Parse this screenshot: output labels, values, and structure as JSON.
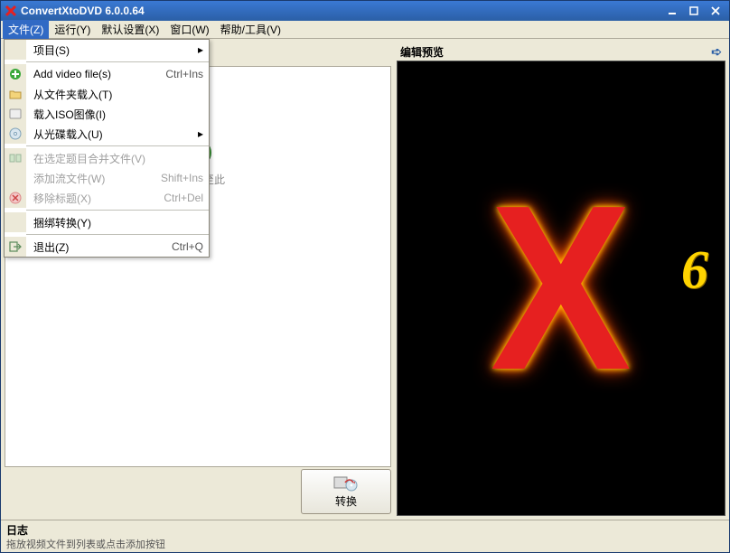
{
  "title": "ConvertXtoDVD 6.0.0.64",
  "menubar": {
    "file": "文件(Z)",
    "run": "运行(Y)",
    "defaults": "默认设置(X)",
    "window": "窗口(W)",
    "help": "帮助/工具(V)"
  },
  "file_menu": {
    "project": "项目(S)",
    "add_video": "Add video file(s)",
    "add_video_shortcut": "Ctrl+Ins",
    "load_folder": "从文件夹载入(T)",
    "load_iso": "载入ISO图像(I)",
    "load_disc": "从光碟载入(U)",
    "merge_selected": "在选定题目合并文件(V)",
    "add_stream": "添加流文件(W)",
    "add_stream_shortcut": "Shift+Ins",
    "remove_title": "移除标题(X)",
    "remove_title_shortcut": "Ctrl+Del",
    "bundle_convert": "捆绑转换(Y)",
    "exit": "退出(Z)",
    "exit_shortcut": "Ctrl+Q"
  },
  "drop_hint": "动文件至此",
  "convert_label": "转换",
  "preview": {
    "header": "编辑预览",
    "logo_version": "6"
  },
  "log": {
    "title": "日志",
    "text": "拖放视频文件到列表或点击添加按钮"
  },
  "icons": {
    "disc": "💿",
    "screen": "▭",
    "film": "🎞",
    "arrow_right": "➪"
  }
}
